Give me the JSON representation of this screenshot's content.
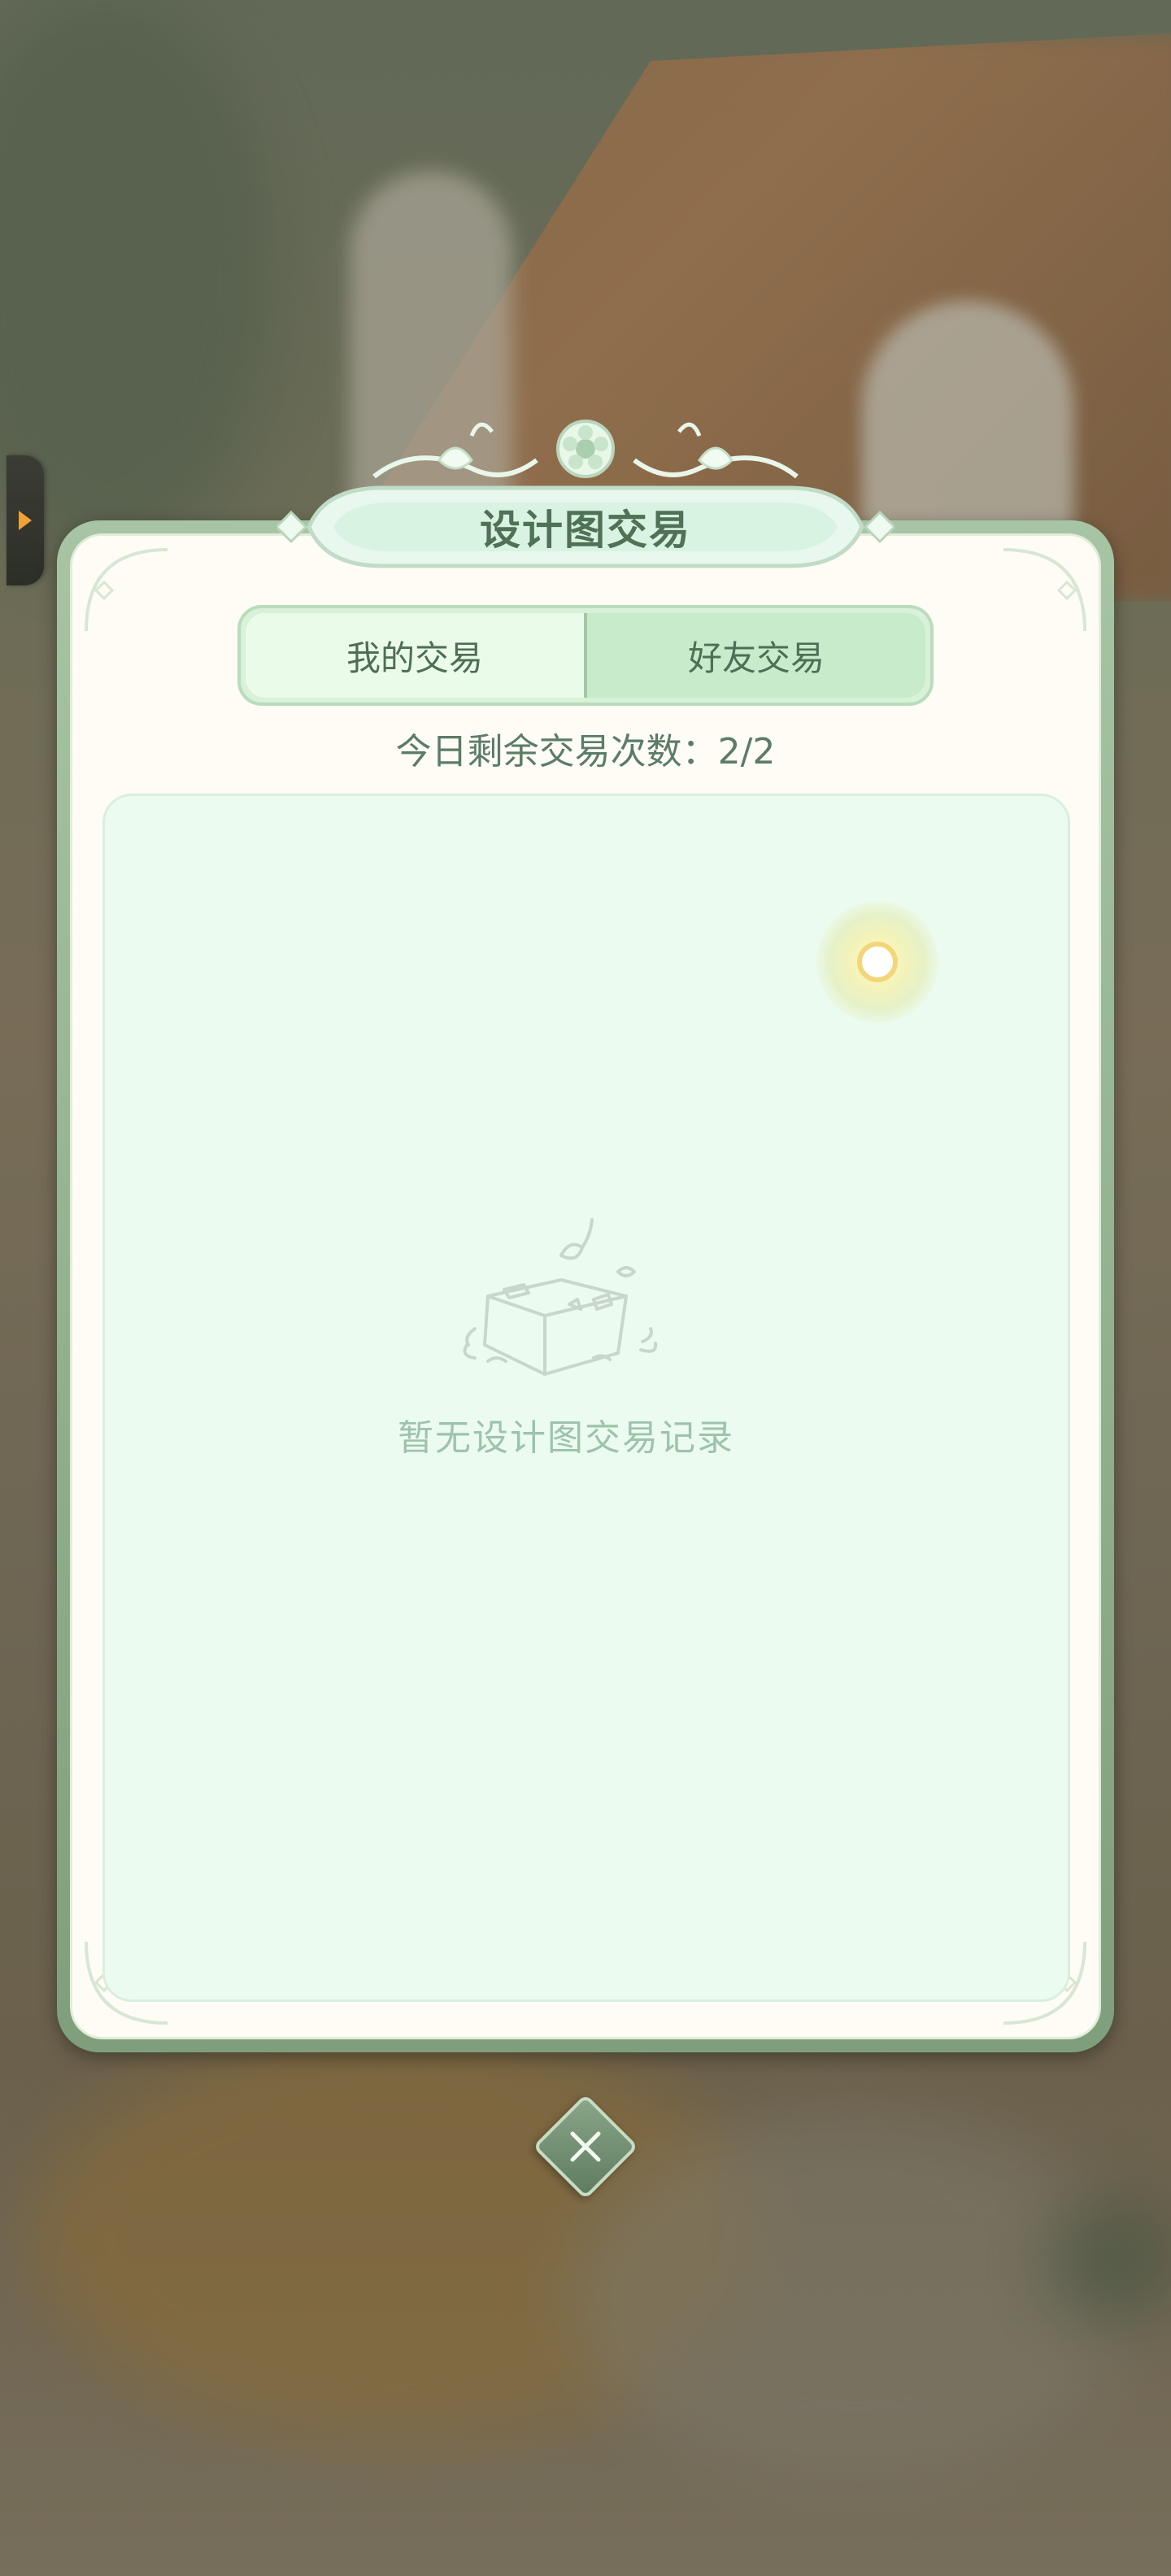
{
  "title": "设计图交易",
  "tabs": [
    {
      "label": "我的交易",
      "selected": false
    },
    {
      "label": "好友交易",
      "selected": true
    }
  ],
  "remaining_label": "今日剩余交易次数：",
  "remaining_value": "2/2",
  "empty_message": "暂无设计图交易记录",
  "icons": [
    "side-arrow-icon",
    "sparkle-icon",
    "empty-box-icon",
    "close-icon"
  ],
  "colors": {
    "accent_green": "#4f7257",
    "panel_bg": "#fffcf6",
    "content_bg": "#ecfbef",
    "side_arrow": "#f0a238"
  }
}
